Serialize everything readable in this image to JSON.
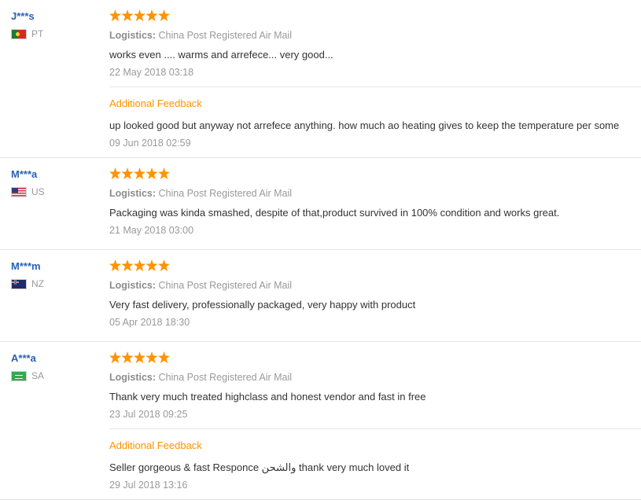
{
  "additional_feedback_label": "Additional Feedback",
  "logistics_label": "Logistics:",
  "colors": {
    "username": "#2a62b3",
    "star": "#ff9300",
    "additional_feedback": "#ff9300",
    "muted": "#999999",
    "text": "#333333"
  },
  "reviews": [
    {
      "user": "J***s",
      "country": "PT",
      "rating": 5,
      "logistics": "China Post Registered Air Mail",
      "text": "works even .... warms and arrefece... very good...",
      "date": "22 May 2018 03:18",
      "followup": {
        "text": "up looked good but anyway not arrefece anything. how much ao heating gives to keep the temperature per some",
        "date": "09 Jun 2018 02:59"
      }
    },
    {
      "user": "M***a",
      "country": "US",
      "rating": 5,
      "logistics": "China Post Registered Air Mail",
      "text": "Packaging was kinda smashed, despite of that,product survived in 100% condition and works great.",
      "date": "21 May 2018 03:00"
    },
    {
      "user": "M***m",
      "country": "NZ",
      "rating": 5,
      "logistics": "China Post Registered Air Mail",
      "text": "Very fast delivery, professionally packaged, very happy with product",
      "date": "05 Apr 2018 18:30"
    },
    {
      "user": "A***a",
      "country": "SA",
      "rating": 5,
      "logistics": "China Post Registered Air Mail",
      "text": "Thank very much treated highclass and honest vendor and fast in free",
      "date": "23 Jul 2018 09:25",
      "followup": {
        "text": "Seller gorgeous & fast Responce والشحن thank very much loved it",
        "date": "29 Jul 2018 13:16"
      }
    }
  ]
}
